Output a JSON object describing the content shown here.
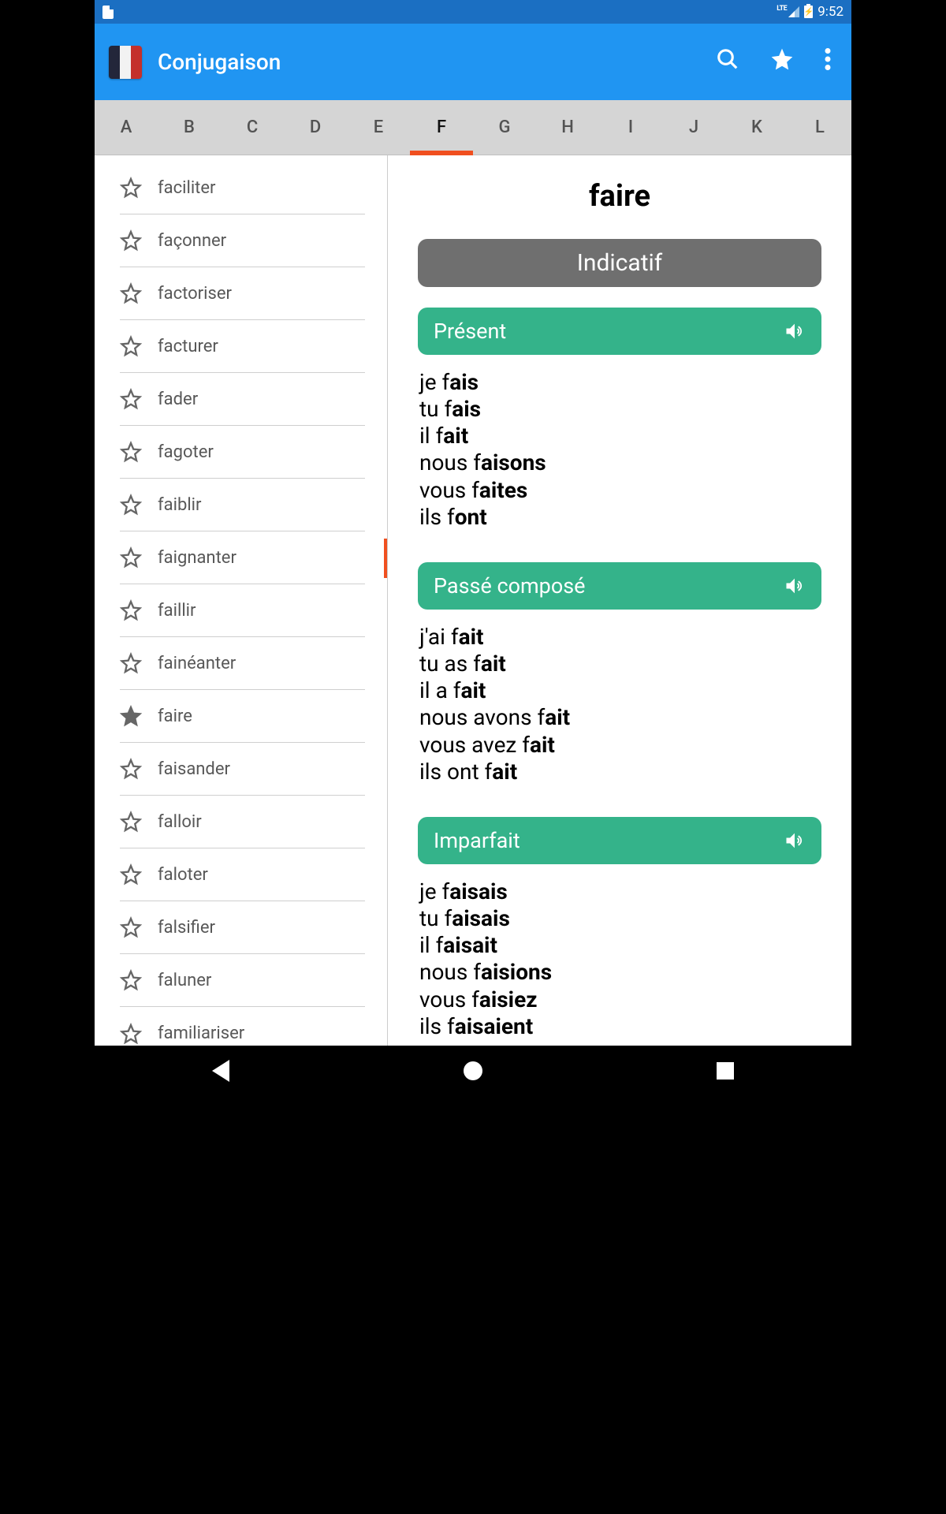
{
  "status": {
    "time": "9:52",
    "network": "LTE"
  },
  "appbar": {
    "title": "Conjugaison"
  },
  "tabs": [
    "A",
    "B",
    "C",
    "D",
    "E",
    "F",
    "G",
    "H",
    "I",
    "J",
    "K",
    "L"
  ],
  "active_tab": "F",
  "verbs": [
    {
      "label": "faciliter",
      "fav": false
    },
    {
      "label": "façonner",
      "fav": false
    },
    {
      "label": "factoriser",
      "fav": false
    },
    {
      "label": "facturer",
      "fav": false
    },
    {
      "label": "fader",
      "fav": false
    },
    {
      "label": "fagoter",
      "fav": false
    },
    {
      "label": "faiblir",
      "fav": false
    },
    {
      "label": "faignanter",
      "fav": false
    },
    {
      "label": "faillir",
      "fav": false
    },
    {
      "label": "fainéanter",
      "fav": false
    },
    {
      "label": "faire",
      "fav": true
    },
    {
      "label": "faisander",
      "fav": false
    },
    {
      "label": "falloir",
      "fav": false
    },
    {
      "label": "faloter",
      "fav": false
    },
    {
      "label": "falsifier",
      "fav": false
    },
    {
      "label": "faluner",
      "fav": false
    },
    {
      "label": "familiariser",
      "fav": false
    }
  ],
  "detail": {
    "verb": "faire",
    "mood": "Indicatif",
    "tenses": [
      {
        "name": "Présent",
        "lines": [
          {
            "stem": "je f",
            "suffix": "ais"
          },
          {
            "stem": "tu f",
            "suffix": "ais"
          },
          {
            "stem": "il f",
            "suffix": "ait"
          },
          {
            "stem": "nous f",
            "suffix": "aisons"
          },
          {
            "stem": "vous f",
            "suffix": "aites"
          },
          {
            "stem": "ils f",
            "suffix": "ont"
          }
        ]
      },
      {
        "name": "Passé composé",
        "lines": [
          {
            "stem": "j'ai f",
            "suffix": "ait"
          },
          {
            "stem": "tu as f",
            "suffix": "ait"
          },
          {
            "stem": "il a f",
            "suffix": "ait"
          },
          {
            "stem": "nous avons f",
            "suffix": "ait"
          },
          {
            "stem": "vous avez f",
            "suffix": "ait"
          },
          {
            "stem": "ils ont f",
            "suffix": "ait"
          }
        ]
      },
      {
        "name": "Imparfait",
        "lines": [
          {
            "stem": "je f",
            "suffix": "aisais"
          },
          {
            "stem": "tu f",
            "suffix": "aisais"
          },
          {
            "stem": "il f",
            "suffix": "aisait"
          },
          {
            "stem": "nous f",
            "suffix": "aisions"
          },
          {
            "stem": "vous f",
            "suffix": "aisiez"
          },
          {
            "stem": "ils f",
            "suffix": "aisaient"
          }
        ]
      }
    ]
  }
}
